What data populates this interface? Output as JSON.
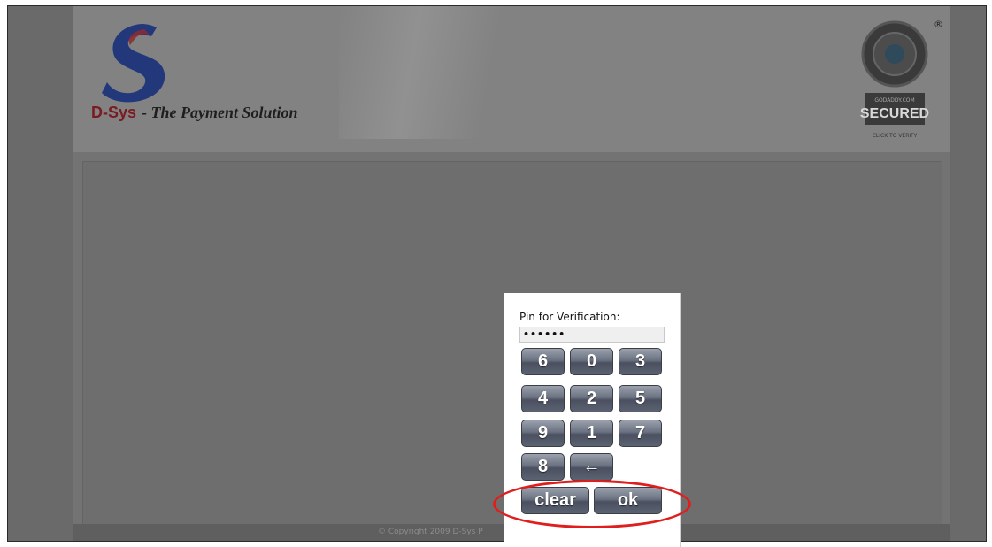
{
  "header": {
    "brand": "D-Sys",
    "tagline": "- The Payment Solution",
    "seal_text_top": "GODADDY.COM",
    "seal_text_main": "SECURED",
    "seal_text_bottom": "CLICK TO VERIFY",
    "seal_reg": "®"
  },
  "footer": {
    "copyright": "© Copyright 2009 D-Sys P"
  },
  "keypad": {
    "label": "Pin for Verification:",
    "pin_value": "••••••",
    "keys": [
      "6",
      "0",
      "3",
      "4",
      "2",
      "5",
      "9",
      "1",
      "7",
      "8"
    ],
    "backspace": "←",
    "clear": "clear",
    "ok": "ok"
  },
  "colors": {
    "overlay": "#6a6a6a",
    "brand_red": "#7a1a22",
    "brand_blue": "#1e3f8f",
    "key_gradient_top": "#9ba1ad",
    "key_gradient_bottom": "#4a5060",
    "highlight_ring": "#e01e1e"
  },
  "icons": {
    "logo": "d-sys-logo-icon",
    "seal": "secured-seal-icon",
    "backspace": "backspace-arrow-icon"
  }
}
